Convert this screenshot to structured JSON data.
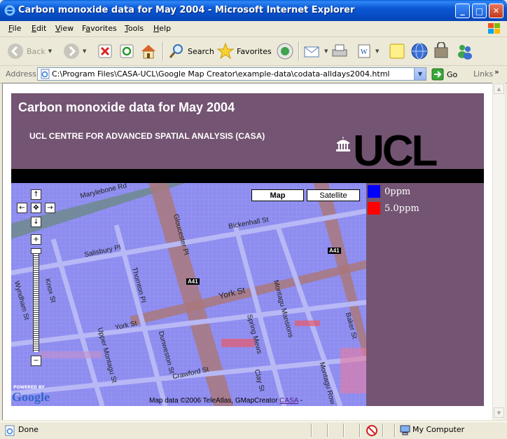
{
  "window": {
    "title": "Carbon monoxide data for May 2004 - Microsoft Internet Explorer",
    "minimize": "_",
    "maximize": "□",
    "close": "✕"
  },
  "menu": {
    "items": [
      {
        "underline": "F",
        "rest": "ile"
      },
      {
        "underline": "E",
        "rest": "dit"
      },
      {
        "underline": "V",
        "rest": "iew"
      },
      {
        "pre": "F",
        "underline": "a",
        "rest": "vorites"
      },
      {
        "underline": "T",
        "rest": "ools"
      },
      {
        "underline": "H",
        "rest": "elp"
      }
    ]
  },
  "toolbar": {
    "back_label": "Back",
    "search_label": "Search",
    "favorites_label": "Favorites"
  },
  "address": {
    "label": "Address",
    "url": "C:\\Program Files\\CASA-UCL\\Google Map Creator\\example-data\\codata-alldays2004.html",
    "go_label": "Go",
    "links_label": "Links",
    "links_chevron": "»"
  },
  "page": {
    "title": "Carbon monoxide data for May 2004",
    "subtitle": "UCL CENTRE FOR ADVANCED SPATIAL ANALYSIS (CASA)",
    "logo_text": "UCL"
  },
  "map": {
    "type_buttons": [
      "Map",
      "Satellite"
    ],
    "active_type": "Map",
    "pan": {
      "up": "↑",
      "left": "←",
      "center": "✥",
      "right": "→",
      "down": "↓"
    },
    "zoom_in": "+",
    "zoom_out": "−",
    "powered_by": "POWERED BY",
    "google": "Google",
    "copyright_prefix": "Map data ©2006 TeleAtlas, GMapCreator ",
    "copyright_link": "CASA",
    "copyright_suffix": " -",
    "streets": [
      "Marylebone Rd",
      "Gloucester Pl",
      "Bickenhall St",
      "Salisbury Pl",
      "Thornton Pl",
      "Knox St",
      "Wyndham St",
      "York St",
      "York St",
      "Upper Montagu St",
      "Dunweston St",
      "Crawford St",
      "Spring Mews",
      "Montagu Mansions",
      "Clay St",
      "Montagu Row",
      "Baker St"
    ],
    "road_labels": [
      "A41",
      "A41"
    ]
  },
  "legend": [
    {
      "label": "0ppm",
      "color": "#0000ff"
    },
    {
      "label": "5.0ppm",
      "color": "#ff0000"
    }
  ],
  "status": {
    "text": "Done",
    "zone": "My Computer"
  },
  "colors": {
    "header_bg": "#735472",
    "titlebar_blue": "#0a57d4",
    "map_overlay": "#8f8ff0"
  }
}
